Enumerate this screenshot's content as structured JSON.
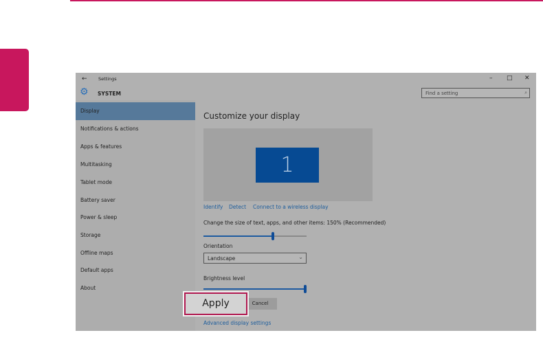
{
  "window": {
    "title": "Settings",
    "section": "SYSTEM",
    "search_placeholder": "Find a setting"
  },
  "sidebar": {
    "items": [
      {
        "label": "Display"
      },
      {
        "label": "Notifications & actions"
      },
      {
        "label": "Apps & features"
      },
      {
        "label": "Multitasking"
      },
      {
        "label": "Tablet mode"
      },
      {
        "label": "Battery saver"
      },
      {
        "label": "Power & sleep"
      },
      {
        "label": "Storage"
      },
      {
        "label": "Offline maps"
      },
      {
        "label": "Default apps"
      },
      {
        "label": "About"
      }
    ]
  },
  "main": {
    "title": "Customize your display",
    "monitor_number": "1",
    "links": {
      "identify": "Identify",
      "detect": "Detect",
      "wireless": "Connect to a wireless display"
    },
    "scale_label": "Change the size of text, apps, and other items: 150% (Recommended)",
    "scale_fraction": 0.67,
    "orientation_label": "Orientation",
    "orientation_value": "Landscape",
    "brightness_label": "Brightness level",
    "brightness_fraction": 1.0,
    "apply": "Apply",
    "cancel": "Cancel",
    "advanced": "Advanced display settings"
  },
  "colors": {
    "accent": "#c8175d",
    "selection": "#56799a",
    "monitor": "#064a93"
  }
}
